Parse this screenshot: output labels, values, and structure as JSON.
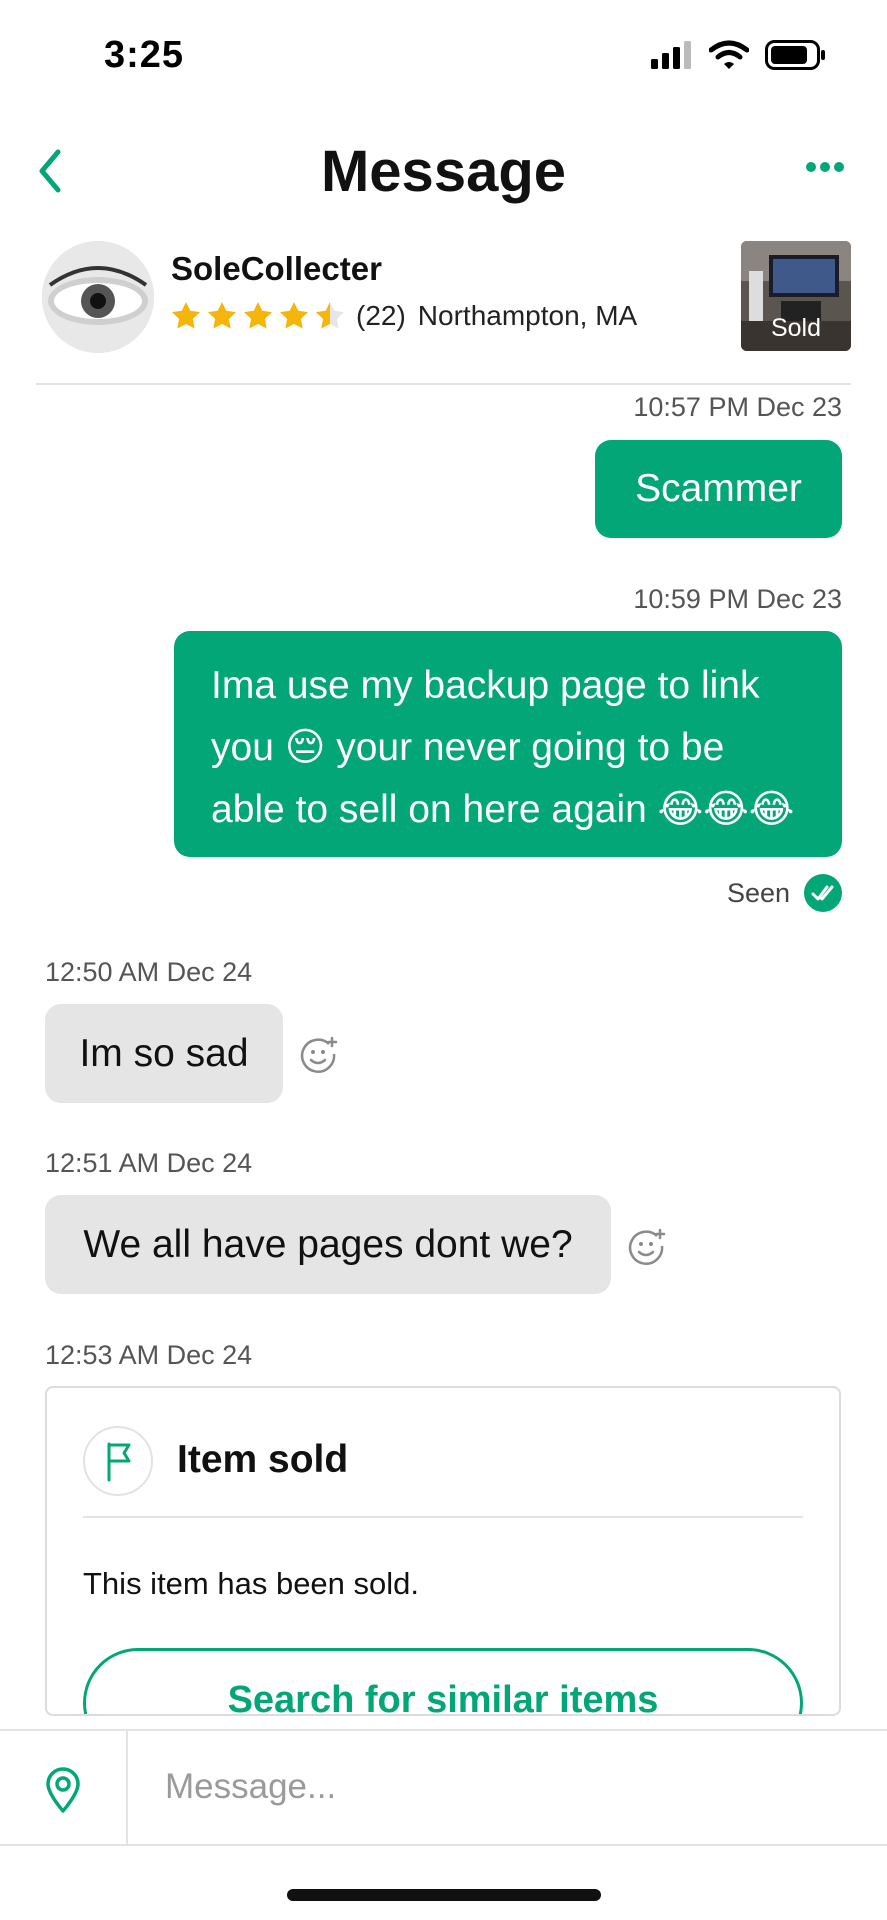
{
  "status_bar": {
    "time": "3:25"
  },
  "header": {
    "title": "Message"
  },
  "seller": {
    "name": "SoleCollecter",
    "rating": 4.5,
    "review_count": "(22)",
    "location": "Northampton, MA"
  },
  "item": {
    "status_label": "Sold"
  },
  "messages": [
    {
      "direction": "outgoing",
      "timestamp": "10:57 PM Dec 23",
      "text": "Scammer"
    },
    {
      "direction": "outgoing",
      "timestamp": "10:59 PM Dec 23",
      "text_lines": [
        "Ima use my backup page to link",
        "you 😔 your never going to be",
        "able to sell on here again 😂😂😂"
      ]
    },
    {
      "direction": "incoming",
      "timestamp": "12:50 AM Dec 24",
      "text": "Im so sad"
    },
    {
      "direction": "incoming",
      "timestamp": "12:51 AM Dec 24",
      "text": "We all have pages dont we?"
    }
  ],
  "seen_label": "Seen",
  "system_card": {
    "timestamp": "12:53 AM Dec 24",
    "title": "Item sold",
    "body": "This item has been sold.",
    "button_label": "Search for similar items"
  },
  "composer": {
    "placeholder": "Message..."
  },
  "colors": {
    "accent": "#03a677",
    "incoming_bubble": "#e5e5e5",
    "star": "#f5b50a"
  },
  "icons": [
    "back-icon",
    "more-icon",
    "star-icon",
    "double-check-icon",
    "add-reaction-icon",
    "flag-icon",
    "location-pin-icon"
  ]
}
